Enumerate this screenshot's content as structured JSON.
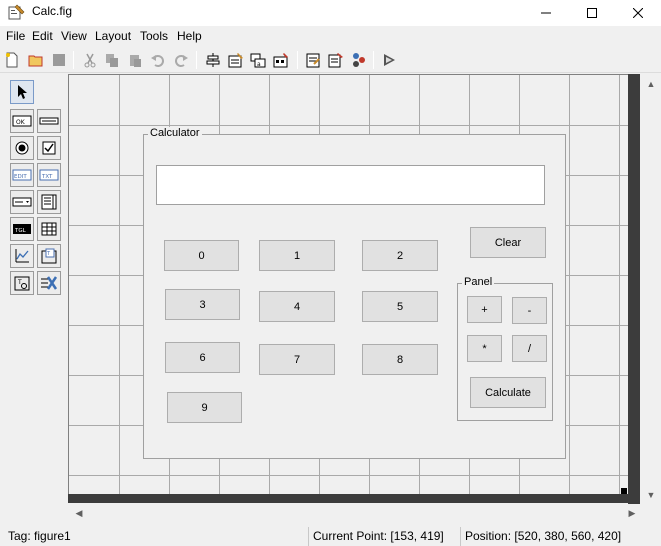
{
  "window": {
    "title": "Calc.fig",
    "icons": [
      "app-icon",
      "minimize-icon",
      "maximize-icon",
      "close-icon"
    ]
  },
  "menu": [
    "File",
    "Edit",
    "View",
    "Layout",
    "Tools",
    "Help"
  ],
  "toolbar_icons": [
    "new-icon",
    "open-icon",
    "save-icon",
    "cut-icon",
    "copy-icon",
    "paste-icon",
    "undo-icon",
    "redo-icon",
    "align-icon",
    "menu-editor-icon",
    "tab-order-icon",
    "toolbar-editor-icon",
    "editor-icon",
    "property-inspector-icon",
    "object-browser-icon",
    "run-icon"
  ],
  "palette_icons": [
    "select-icon",
    "pushbutton-icon",
    "slider-icon",
    "radio-button-icon",
    "checkbox-icon",
    "edit-text-icon",
    "static-text-icon",
    "popup-menu-icon",
    "listbox-icon",
    "toggle-button-icon",
    "table-icon",
    "axes-icon",
    "panel-icon",
    "button-group-icon",
    "activex-icon"
  ],
  "palette_glyphs": {
    "ok": "OK",
    "edit": "EDIT",
    "txt": "TXT",
    "tgl": "TGL"
  },
  "design": {
    "outer_panel_title": "Calculator",
    "inner_panel_title": "Panel",
    "display_value": "",
    "digits": [
      "0",
      "1",
      "2",
      "3",
      "4",
      "5",
      "6",
      "7",
      "8",
      "9"
    ],
    "clear_label": "Clear",
    "plus_label": "+",
    "minus_label": "-",
    "multiply_label": "*",
    "divide_label": "/",
    "calculate_label": "Calculate"
  },
  "status": {
    "tag": "Tag: figure1",
    "current_point_label": "Current Point:",
    "current_point_value": "[153, 419]",
    "position": "Position: [520, 380, 560, 420]"
  }
}
